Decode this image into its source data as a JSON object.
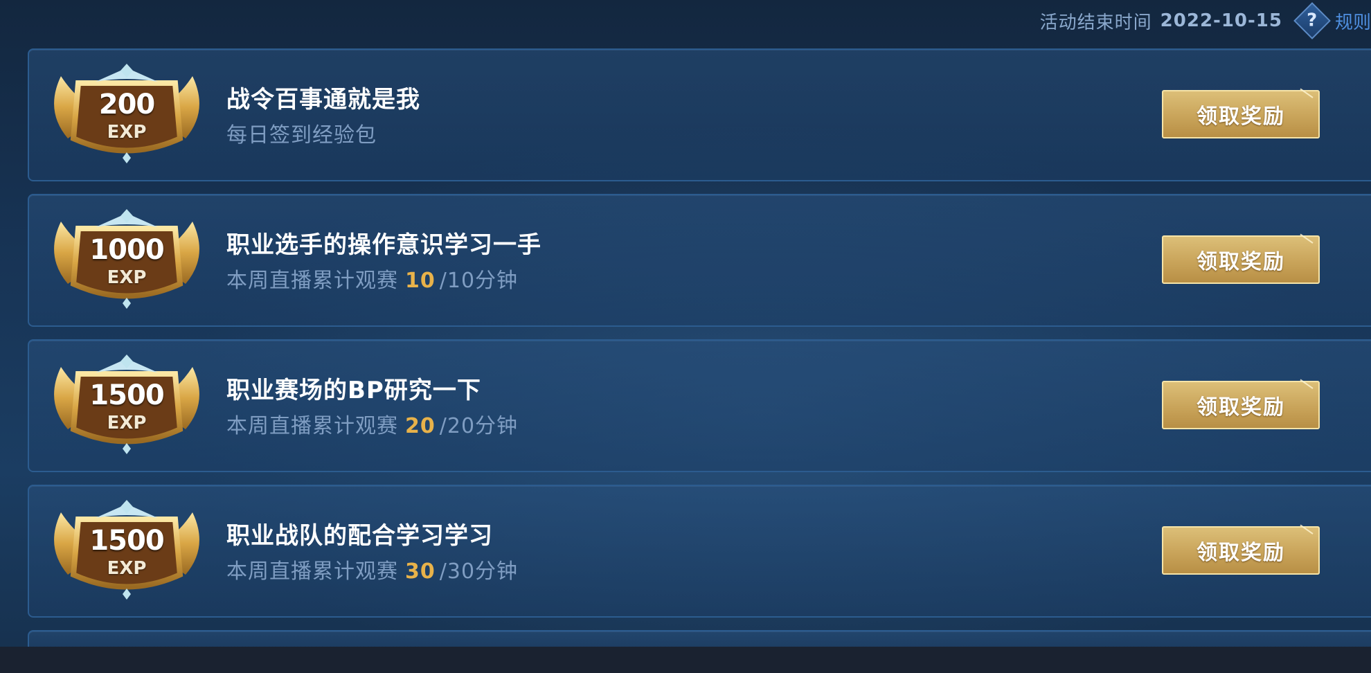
{
  "header": {
    "end_label": "活动结束时间",
    "end_date": "2022-10-15",
    "help_symbol": "?",
    "rules_label": "规则"
  },
  "tasks": [
    {
      "amount": "200",
      "unit": "EXP",
      "title": "战令百事通就是我",
      "subtitle": "每日签到经验包",
      "progress": "",
      "target": "",
      "button_label": "领取奖励"
    },
    {
      "amount": "1000",
      "unit": "EXP",
      "title": "职业选手的操作意识学习一手",
      "subtitle": "本周直播累计观赛",
      "progress": "10",
      "target": "/10分钟",
      "button_label": "领取奖励"
    },
    {
      "amount": "1500",
      "unit": "EXP",
      "title": "职业赛场的BP研究一下",
      "subtitle": "本周直播累计观赛",
      "progress": "20",
      "target": "/20分钟",
      "button_label": "领取奖励"
    },
    {
      "amount": "1500",
      "unit": "EXP",
      "title": "职业战队的配合学习学习",
      "subtitle": "本周直播累计观赛",
      "progress": "30",
      "target": "/30分钟",
      "button_label": "领取奖励"
    }
  ],
  "colors": {
    "progress": "#e8b24a",
    "button_gold": "#c9a45a",
    "card_border": "#2c5c8f",
    "rules_link": "#4f8fe0"
  },
  "icons": {
    "badge": "exp-badge-icon",
    "help": "help-icon"
  }
}
